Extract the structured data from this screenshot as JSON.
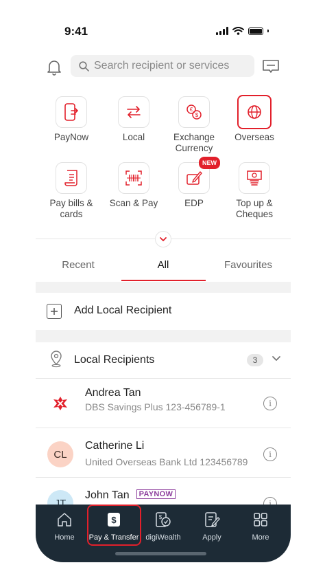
{
  "status": {
    "time": "9:41"
  },
  "search": {
    "placeholder": "Search recipient or services"
  },
  "quick_actions": [
    {
      "label": "PayNow",
      "icon": "paynow-phone-icon"
    },
    {
      "label": "Local",
      "icon": "transfer-arrows-icon"
    },
    {
      "label": "Exchange Currency",
      "label_line2": "Currency",
      "label_line1": "Exchange",
      "icon": "currency-exchange-icon"
    },
    {
      "label": "Overseas",
      "icon": "globe-icon",
      "highlighted": true
    },
    {
      "label_line1": "Pay bills &",
      "label_line2": "cards",
      "icon": "bill-receipt-icon"
    },
    {
      "label": "Scan & Pay",
      "icon": "barcode-scan-icon"
    },
    {
      "label": "EDP",
      "icon": "edp-pen-icon",
      "badge": "NEW"
    },
    {
      "label_line1": "Top up &",
      "label_line2": "Cheques",
      "icon": "cash-stack-icon"
    }
  ],
  "tabs": [
    {
      "label": "Recent"
    },
    {
      "label": "All",
      "active": true
    },
    {
      "label": "Favourites"
    }
  ],
  "add_recipient": {
    "label": "Add Local Recipient"
  },
  "local_section": {
    "title": "Local Recipients",
    "count": "3"
  },
  "recipients": [
    {
      "name": "Andrea Tan",
      "detail": "DBS Savings Plus 123-456789-1",
      "avatar": "dbs-logo"
    },
    {
      "name": "Catherine Li",
      "detail": "United Overseas Bank Ltd 123456789",
      "initials": "CL"
    },
    {
      "name": "John Tan",
      "initials": "JT",
      "tag": "PAYNOW"
    }
  ],
  "bottom_nav": [
    {
      "label": "Home",
      "icon": "home-icon"
    },
    {
      "label": "Pay & Transfer",
      "icon": "dollar-card-icon",
      "active": true
    },
    {
      "label": "digiWealth",
      "icon": "wealth-icon"
    },
    {
      "label": "Apply",
      "icon": "apply-form-icon"
    },
    {
      "label": "More",
      "icon": "grid-icon"
    }
  ],
  "colors": {
    "accent": "#e2202b",
    "nav_bg": "#1d2b36",
    "paynow": "#8d3e9d"
  }
}
